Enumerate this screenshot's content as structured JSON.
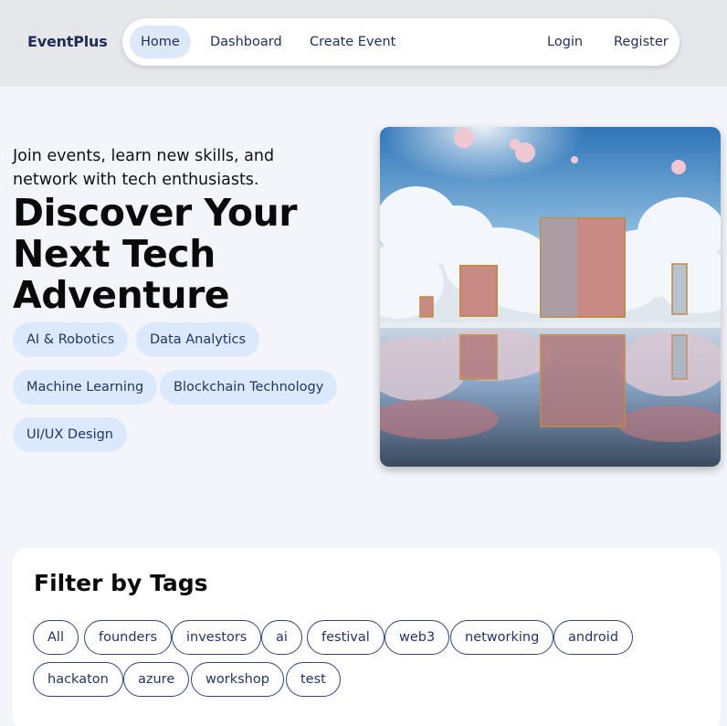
{
  "brand": "EventPlus",
  "nav": {
    "home": "Home",
    "dashboard": "Dashboard",
    "create_event": "Create Event",
    "login": "Login",
    "register": "Register"
  },
  "hero": {
    "subtitle": "Join events, learn new skills, and network with tech enthusiasts.",
    "title": "Discover Your Next Tech Adventure",
    "topics": [
      "AI & Robotics",
      "Data Analytics",
      "Machine Learning",
      "Blockchain Technology",
      "UI/UX Design"
    ]
  },
  "filter": {
    "title": "Filter by Tags",
    "tags": [
      "All",
      "founders",
      "investors",
      "ai",
      "festival",
      "web3",
      "networking",
      "android",
      "hackaton",
      "azure",
      "workshop",
      "test"
    ]
  },
  "colors": {
    "accent": "#dde8fb",
    "brand_text": "#1f2d5a",
    "tag_border": "#31457c"
  }
}
